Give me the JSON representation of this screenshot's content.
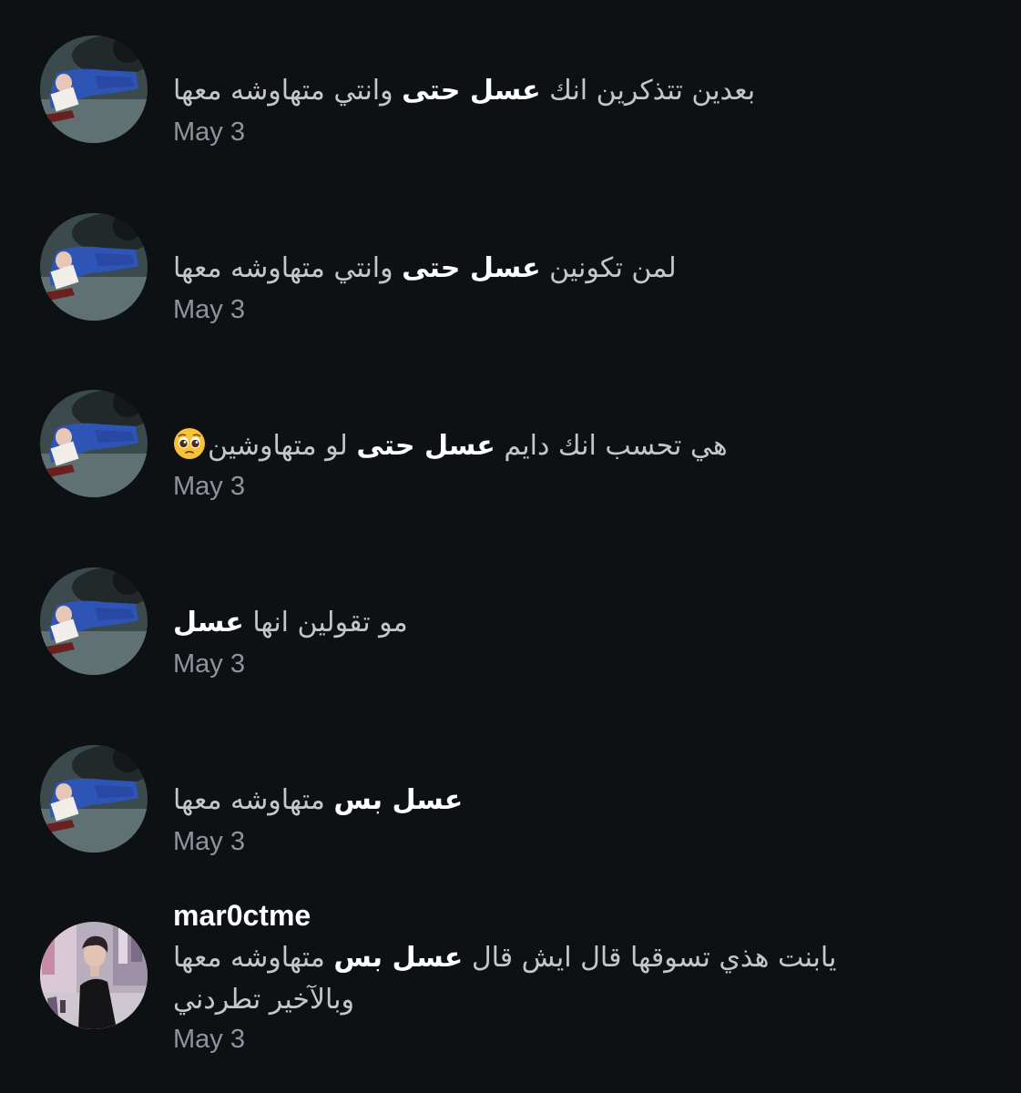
{
  "comments": [
    {
      "parts": [
        "بعدين تتذكرين انك ",
        "عسل حتى",
        " وانتي متهاوشه معها"
      ],
      "date": "May 3",
      "avatar_icon": "user-avatar-blue-hoodie"
    },
    {
      "parts": [
        "لمن تكونين ",
        "عسل حتى",
        " وانتي متهاوشه معها"
      ],
      "date": "May 3",
      "avatar_icon": "user-avatar-blue-hoodie"
    },
    {
      "parts": [
        "هي تحسب انك دايم ",
        "عسل حتى",
        " لو متهاوشين"
      ],
      "emoji": "pleading-face-icon",
      "date": "May 3",
      "avatar_icon": "user-avatar-blue-hoodie"
    },
    {
      "parts": [
        "مو تقولين انها ",
        "عسل"
      ],
      "date": "May 3",
      "avatar_icon": "user-avatar-blue-hoodie"
    },
    {
      "parts": [
        "",
        "عسل بس",
        " متهاوشه معها"
      ],
      "date": "May 3",
      "avatar_icon": "user-avatar-blue-hoodie"
    },
    {
      "username": "mar0ctme",
      "parts": [
        "يابنت هذي تسوقها قال ايش قال ",
        "عسل بس",
        " متهاوشه معها"
      ],
      "line2": "وبالآخير تطردني",
      "date": "May 3",
      "avatar_icon": "user-avatar-street-photo"
    }
  ],
  "colors": {
    "background": "#0e1114",
    "text": "#c3c7cc",
    "bold_text": "#ffffff",
    "date": "#8e949b"
  }
}
